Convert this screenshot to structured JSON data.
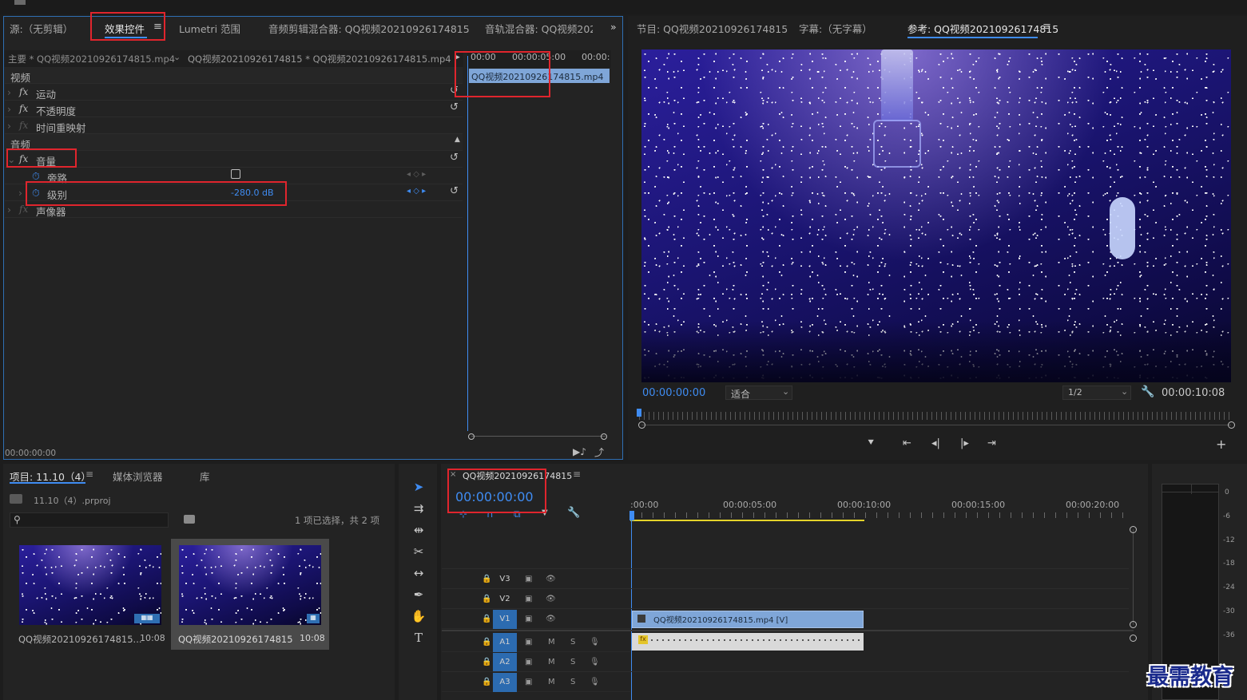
{
  "top_tabs": {
    "source": "源:（无剪辑）",
    "effect_controls": "效果控件",
    "lumetri": "Lumetri 范围",
    "audio_clip_mixer": "音频剪辑混合器: QQ视频20210926174815",
    "audio_track_mixer": "音轨混合器: QQ视频202",
    "program": "节目: QQ视频20210926174815",
    "captions": "字幕:（无字幕）",
    "reference": "参考: QQ视频20210926174815"
  },
  "effect_controls": {
    "master_label": "主要 * QQ视频20210926174815.mp4",
    "sequence_label": "QQ视频20210926174815 * QQ视频20210926174815.mp4",
    "ruler": [
      "00:00",
      "00:00:05:00",
      "00:00:"
    ],
    "clip_name": "QQ视频20210926174815.mp4",
    "video_header": "视频",
    "motion": "运动",
    "opacity": "不透明度",
    "time_remap": "时间重映射",
    "audio_header": "音频",
    "volume": "音量",
    "bypass": "旁路",
    "level": "级别",
    "level_value": "-280.0 dB",
    "panner": "声像器",
    "timecode": "00:00:00:00"
  },
  "program_monitor": {
    "timecode": "00:00:00:00",
    "fit": "适合",
    "resolution": "1/2",
    "duration": "00:00:10:08"
  },
  "project": {
    "tab_project": "项目: 11.10（4）",
    "tab_media": "媒体浏览器",
    "tab_library": "库",
    "proj_file": "11.10（4）.prproj",
    "selection_info": "1 项已选择，共 2 项",
    "items": [
      {
        "name": "QQ视频20210926174815...",
        "duration": "10:08"
      },
      {
        "name": "QQ视频20210926174815",
        "duration": "10:08"
      }
    ]
  },
  "timeline": {
    "sequence_name": "QQ视频20210926174815",
    "timecode": "00:00:00:00",
    "ruler": [
      ":00:00",
      "00:00:05:00",
      "00:00:10:00",
      "00:00:15:00",
      "00:00:20:00"
    ],
    "tracks": [
      "V3",
      "V2",
      "V1",
      "A1",
      "A2",
      "A3"
    ],
    "mute_label": "M",
    "solo_label": "S",
    "video_clip": "QQ视频20210926174815.mp4 [V]"
  },
  "meter_scale": [
    "0",
    "-6",
    "-12",
    "-18",
    "-24",
    "-30",
    "-36"
  ],
  "watermark": "最需教育",
  "colors": {
    "accent": "#3f8cf2",
    "highlight": "#e0252d",
    "clip_video": "#7fa6d8"
  }
}
